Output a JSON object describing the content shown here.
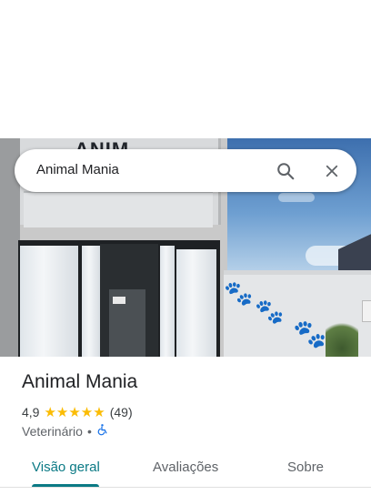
{
  "search": {
    "value": "Animal Mania",
    "search_icon": "search-icon",
    "close_icon": "close-icon"
  },
  "photo": {
    "sign_text": "ANIM"
  },
  "place": {
    "title": "Animal Mania",
    "rating": "4,9",
    "stars": "★★★★★",
    "reviews_count": "(49)",
    "category": "Veterinário",
    "separator": "•",
    "accessibility_icon": "wheelchair-icon"
  },
  "tabs": [
    {
      "label": "Visão geral",
      "active": true
    },
    {
      "label": "Avaliações",
      "active": false
    },
    {
      "label": "Sobre",
      "active": false
    }
  ],
  "colors": {
    "accent": "#0b7a85",
    "star": "#fbbc04",
    "accessibility": "#1a73e8"
  }
}
